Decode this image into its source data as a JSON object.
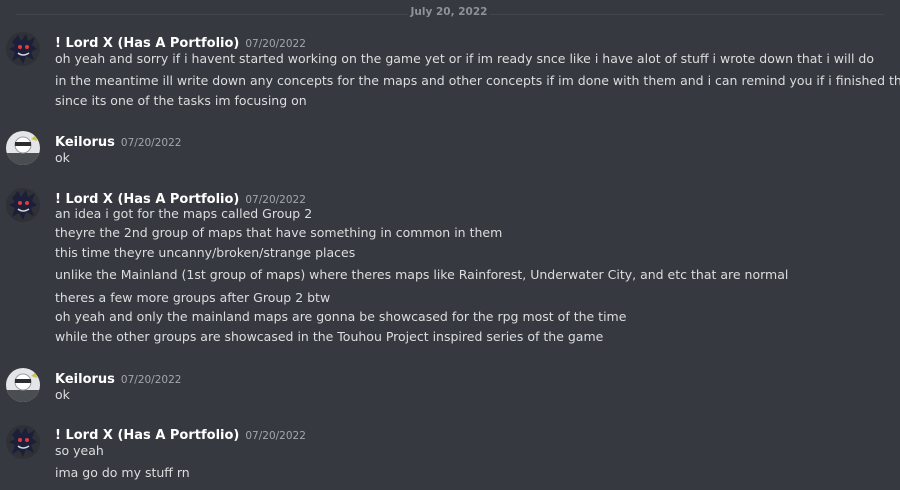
{
  "date_divider": "July 20, 2022",
  "colors": {
    "background": "#36393f",
    "username": "#ffffff",
    "text": "#dcddde",
    "timestamp": "#a3a6aa"
  },
  "messages": [
    {
      "author": "! Lord X (Has A Portfolio)",
      "timestamp": "07/20/2022",
      "avatar": "lord-x-avatar",
      "lines": [
        "oh yeah and sorry if i havent started working on the game  yet or if im ready snce like i have alot of stuff i wrote down that i will do",
        "in the meantime ill write down any concepts for the maps and other concepts if im done with them and i can remind you if i finished them",
        "since its one of the tasks im focusing on"
      ]
    },
    {
      "author": "Keilorus",
      "timestamp": "07/20/2022",
      "avatar": "keilorus-avatar",
      "lines": [
        "ok"
      ]
    },
    {
      "author": "! Lord X (Has A Portfolio)",
      "timestamp": "07/20/2022",
      "avatar": "lord-x-avatar",
      "lines": [
        "an idea i got for the maps called Group 2",
        "theyre the 2nd group of maps that have something in common in them",
        "this time theyre uncanny/broken/strange places",
        "unlike the Mainland (1st group of maps) where theres maps like Rainforest, Underwater City, and etc that are normal",
        "theres a few more groups after Group 2 btw",
        "oh yeah and only the mainland maps are gonna be showcased for the rpg most of the time",
        "while the other groups are showcased in the Touhou Project inspired series of the game"
      ]
    },
    {
      "author": "Keilorus",
      "timestamp": "07/20/2022",
      "avatar": "keilorus-avatar",
      "lines": [
        "ok"
      ]
    },
    {
      "author": "! Lord X (Has A Portfolio)",
      "timestamp": "07/20/2022",
      "avatar": "lord-x-avatar",
      "lines": [
        "so yeah",
        "ima go do my stuff rn"
      ]
    }
  ]
}
